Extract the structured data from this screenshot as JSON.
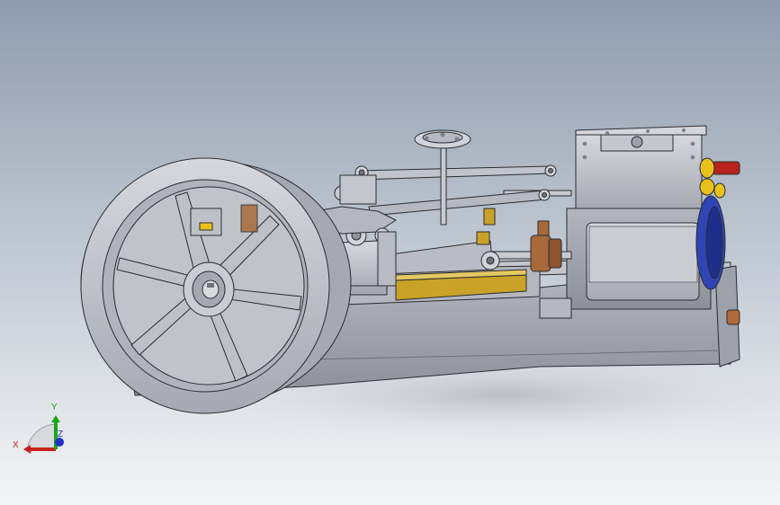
{
  "viewport": {
    "background_top": "#8e9cae",
    "background_bottom": "#f4f5f7"
  },
  "model": {
    "body_color": "#b9bcc4",
    "shadow_color": "#c9ccd2",
    "brass_color": "#c9a227",
    "bronze_color": "#a86a3a",
    "red_part_color": "#b8241c",
    "yellow_part_color": "#e8c21a",
    "blue_part_color": "#2f44b5",
    "edge_color": "#2a2c30"
  },
  "triad": {
    "x_label": "X",
    "y_label": "Y",
    "z_label": "Z",
    "x_color": "#c8201c",
    "y_color": "#1aa51a",
    "z_color": "#2030c8"
  }
}
